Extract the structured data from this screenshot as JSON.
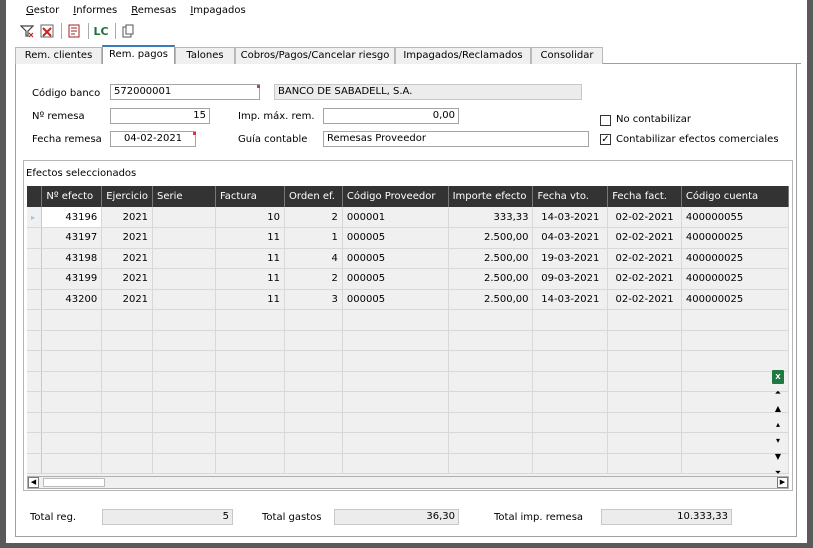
{
  "menu": [
    "Gestor",
    "Informes",
    "Remesas",
    "Impagados"
  ],
  "toolbar": {
    "icons": [
      "filter-clear-icon",
      "excel-delete-icon",
      "document-icon",
      "lc-icon",
      "copy-icon"
    ],
    "lc_label": "LC"
  },
  "tabs": [
    {
      "label": "Rem. clientes"
    },
    {
      "label": "Rem. pagos"
    },
    {
      "label": "Talones"
    },
    {
      "label": "Cobros/Pagos/Cancelar riesgo"
    },
    {
      "label": "Impagados/Reclamados"
    },
    {
      "label": "Consolidar"
    }
  ],
  "form": {
    "codigo_banco_label": "Código banco",
    "codigo_banco": "572000001",
    "banco_nombre": "BANCO DE SABADELL, S.A.",
    "nremesa_label": "Nº remesa",
    "nremesa": "15",
    "imp_max_label": "Imp. máx. rem.",
    "imp_max": "0,00",
    "fecha_label": "Fecha remesa",
    "fecha": "04-02-2021",
    "guia_label": "Guía contable",
    "guia": "Remesas Proveedor",
    "no_contabilizar_label": "No contabilizar",
    "no_contabilizar_checked": false,
    "contabilizar_label": "Contabilizar efectos comerciales",
    "contabilizar_checked": true,
    "check_mark": "✓"
  },
  "grid": {
    "group_title": "Efectos seleccionados",
    "columns": [
      "Nº efecto",
      "Ejercicio",
      "Serie",
      "Factura",
      "Orden ef.",
      "Código Proveedor",
      "Importe efecto",
      "Fecha vto.",
      "Fecha fact.",
      "Código cuenta"
    ],
    "rows": [
      [
        "43196",
        "2021",
        "",
        "10",
        "2",
        "000001",
        "333,33",
        "14-03-2021",
        "02-02-2021",
        "400000055"
      ],
      [
        "43197",
        "2021",
        "",
        "11",
        "1",
        "000005",
        "2.500,00",
        "04-03-2021",
        "02-02-2021",
        "400000025"
      ],
      [
        "43198",
        "2021",
        "",
        "11",
        "4",
        "000005",
        "2.500,00",
        "19-03-2021",
        "02-02-2021",
        "400000025"
      ],
      [
        "43199",
        "2021",
        "",
        "11",
        "2",
        "000005",
        "2.500,00",
        "09-03-2021",
        "02-02-2021",
        "400000025"
      ],
      [
        "43200",
        "2021",
        "",
        "11",
        "3",
        "000005",
        "2.500,00",
        "14-03-2021",
        "02-02-2021",
        "400000025"
      ]
    ],
    "row_indicator": "▸"
  },
  "footer": {
    "total_reg_label": "Total reg.",
    "total_reg": "5",
    "total_gastos_label": "Total gastos",
    "total_gastos": "36,30",
    "total_imp_label": "Total imp. remesa",
    "total_imp": "10.333,33"
  },
  "colors": {
    "grid_header": "#333333",
    "active_tab_accent": "#3c7ac0",
    "required_marker": "#e0304a",
    "excel_green": "#1f7a3f"
  }
}
